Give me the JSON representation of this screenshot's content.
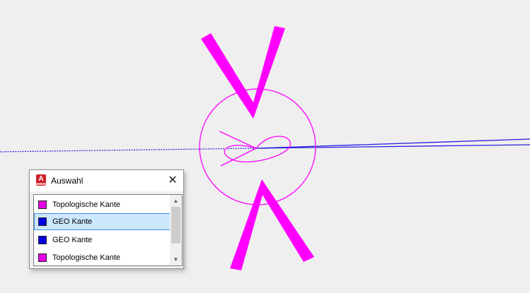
{
  "dialog": {
    "title": "Auswahl",
    "app_icon_letter": "A",
    "close_glyph": "✕",
    "list": {
      "items": [
        {
          "label": "Topologische Kante",
          "color": "#e600e6",
          "selected": false
        },
        {
          "label": "GEO Kante",
          "color": "#0000e0",
          "selected": true
        },
        {
          "label": "GEO Kante",
          "color": "#0000e0",
          "selected": false
        },
        {
          "label": "Topologische Kante",
          "color": "#e600e6",
          "selected": false
        }
      ],
      "scroll_up_glyph": "▲",
      "scroll_down_glyph": "▼"
    }
  },
  "drawing": {
    "magenta": "#ff00ff",
    "blue": "#2a1ee0",
    "background": "#efefef"
  }
}
